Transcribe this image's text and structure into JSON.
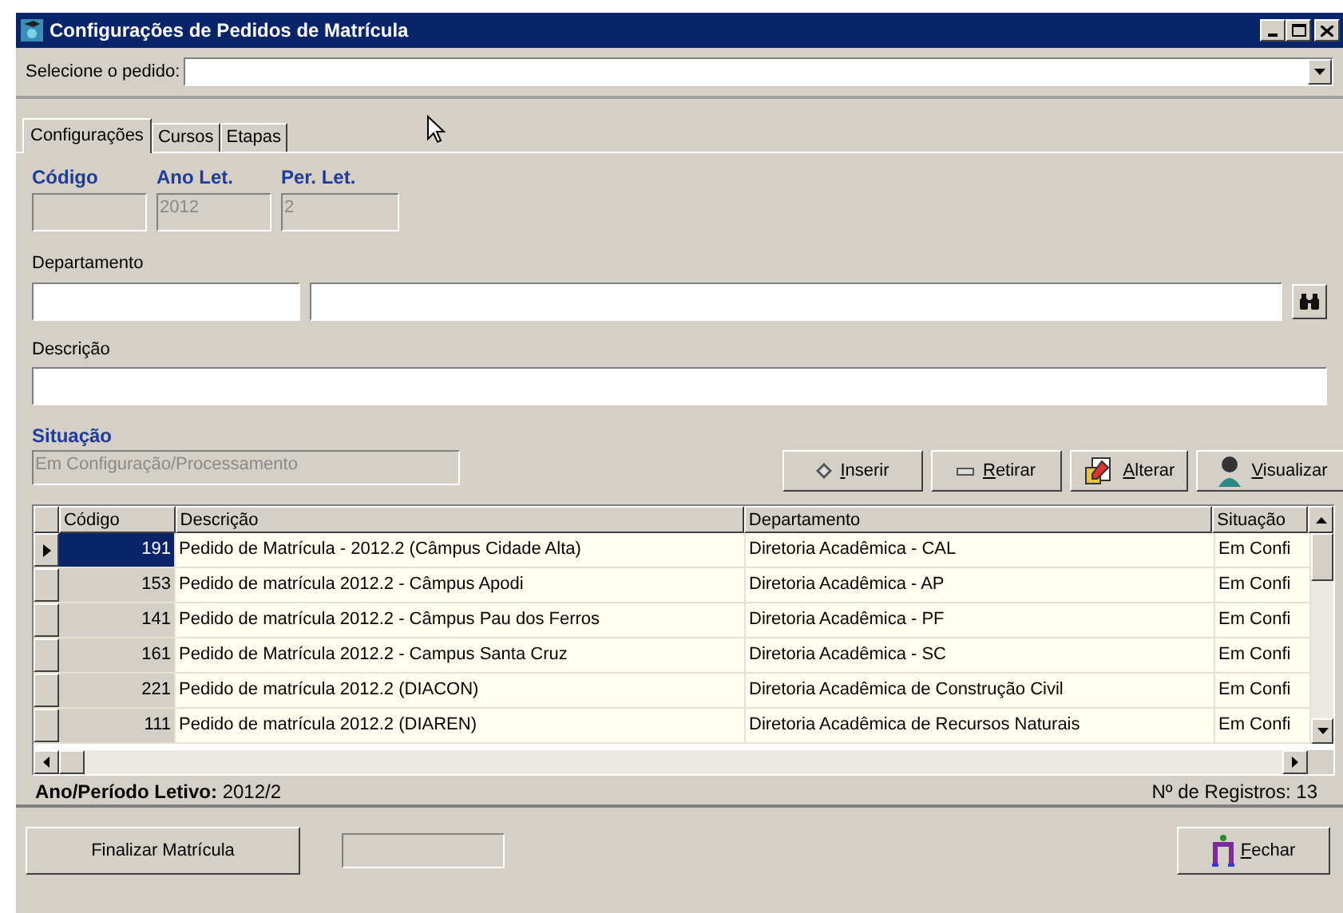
{
  "window": {
    "title": "Configurações de Pedidos de Matrícula"
  },
  "order_select": {
    "label": "Selecione o pedido:"
  },
  "tabs": [
    {
      "label": "Configurações",
      "selected": true
    },
    {
      "label": "Cursos",
      "selected": false
    },
    {
      "label": "Etapas",
      "selected": false
    }
  ],
  "fields": {
    "codigo": {
      "label": "Código"
    },
    "ano": {
      "label": "Ano Let.",
      "value": "2012"
    },
    "periodo": {
      "label": "Per. Let.",
      "value": "2"
    },
    "departamento": {
      "label": "Departamento"
    },
    "descricao": {
      "label": "Descrição"
    },
    "situacao": {
      "label": "Situação",
      "value": "Em Configuração/Processamento"
    }
  },
  "actions": [
    {
      "kind": "insert",
      "label": "Inserir"
    },
    {
      "kind": "remove",
      "label": "Retirar"
    },
    {
      "kind": "edit",
      "label": "Alterar"
    },
    {
      "kind": "view",
      "label": "Visualizar"
    }
  ],
  "table": {
    "columns": [
      "Código",
      "Descrição",
      "Departamento",
      "Situação"
    ],
    "rows": [
      {
        "selected": true,
        "cells": [
          "191",
          "Pedido de Matrícula - 2012.2 (Câmpus Cidade Alta)",
          "Diretoria Acadêmica - CAL",
          "Em Confi"
        ]
      },
      {
        "selected": false,
        "cells": [
          "153",
          "Pedido de matrícula 2012.2 - Câmpus Apodi",
          "Diretoria Acadêmica - AP",
          "Em Confi"
        ]
      },
      {
        "selected": false,
        "cells": [
          "141",
          "Pedido de matrícula 2012.2 - Câmpus Pau dos Ferros",
          "Diretoria Acadêmica - PF",
          "Em Confi"
        ]
      },
      {
        "selected": false,
        "cells": [
          "161",
          "Pedido de Matrícula 2012.2 - Campus Santa Cruz",
          "Diretoria Acadêmica - SC",
          "Em Confi"
        ]
      },
      {
        "selected": false,
        "cells": [
          "221",
          "Pedido de matrícula 2012.2 (DIACON)",
          "Diretoria Acadêmica de Construção Civil",
          "Em Confi"
        ]
      },
      {
        "selected": false,
        "cells": [
          "111",
          "Pedido de matrícula 2012.2 (DIAREN)",
          "Diretoria Acadêmica de Recursos Naturais",
          "Em Confi"
        ]
      }
    ]
  },
  "status_bar": {
    "period_label": "Ano/Período Letivo:",
    "period_value": "2012/2",
    "records": "Nº de Registros: 13"
  },
  "footer": {
    "finalize": "Finalizar Matrícula",
    "close": "Fechar"
  }
}
